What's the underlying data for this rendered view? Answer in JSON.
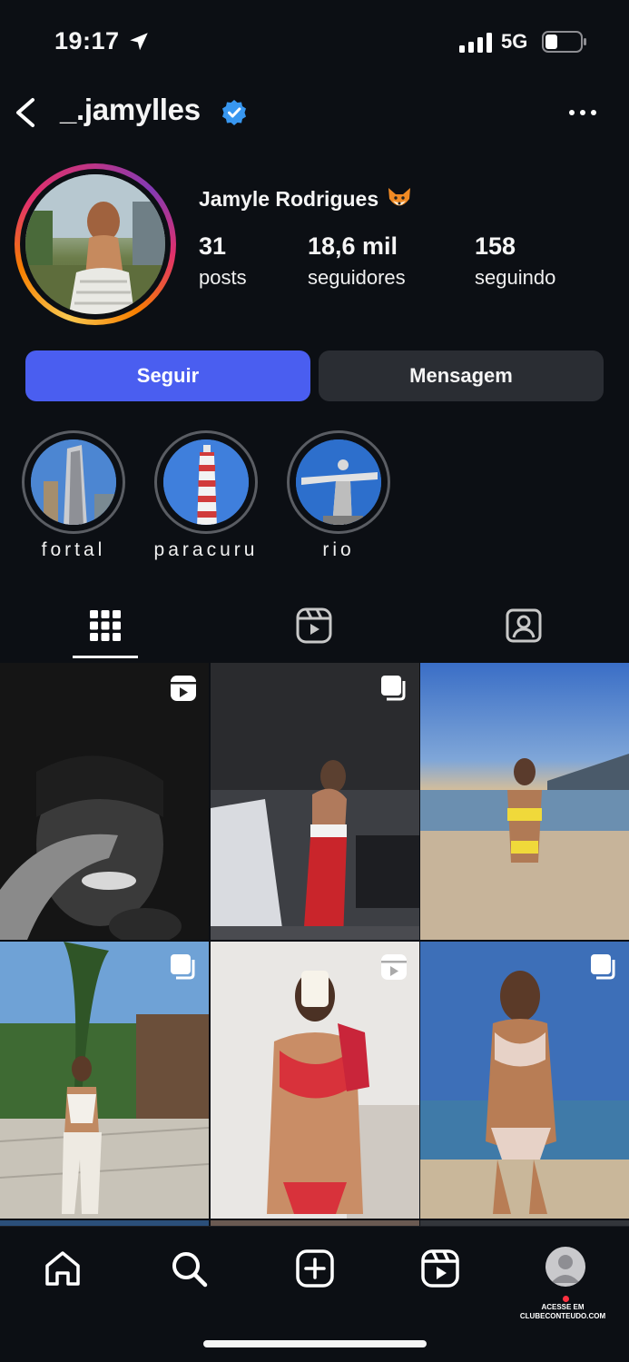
{
  "status_bar": {
    "time": "19:17",
    "network": "5G"
  },
  "header": {
    "username": "_.jamylles"
  },
  "profile": {
    "full_name": "Jamyle Rodrigues",
    "stats": [
      {
        "number": "31",
        "label": "posts"
      },
      {
        "number": "18,6 mil",
        "label": "seguidores"
      },
      {
        "number": "158",
        "label": "seguindo"
      }
    ]
  },
  "actions": {
    "follow_label": "Seguir",
    "message_label": "Mensagem"
  },
  "highlights": [
    {
      "name": "fortal"
    },
    {
      "name": "paracuru"
    },
    {
      "name": "rio"
    }
  ],
  "tabs": [
    {
      "icon": "grid-icon",
      "active": true
    },
    {
      "icon": "reels-icon",
      "active": false
    },
    {
      "icon": "tagged-icon",
      "active": false
    }
  ],
  "posts": [
    {
      "type": "reel"
    },
    {
      "type": "carousel"
    },
    {
      "type": "photo"
    },
    {
      "type": "carousel"
    },
    {
      "type": "reel"
    },
    {
      "type": "carousel"
    }
  ],
  "bottom_nav": {
    "items": [
      "home-icon",
      "search-icon",
      "create-icon",
      "reels-icon",
      "profile-avatar"
    ],
    "watermark_line1": "ACESSE EM",
    "watermark_line2": "CLUBECONTEUDO.COM"
  },
  "colors": {
    "follow_button": "#4a5ef0",
    "verified": "#3897f0",
    "background": "#0c0f14"
  }
}
